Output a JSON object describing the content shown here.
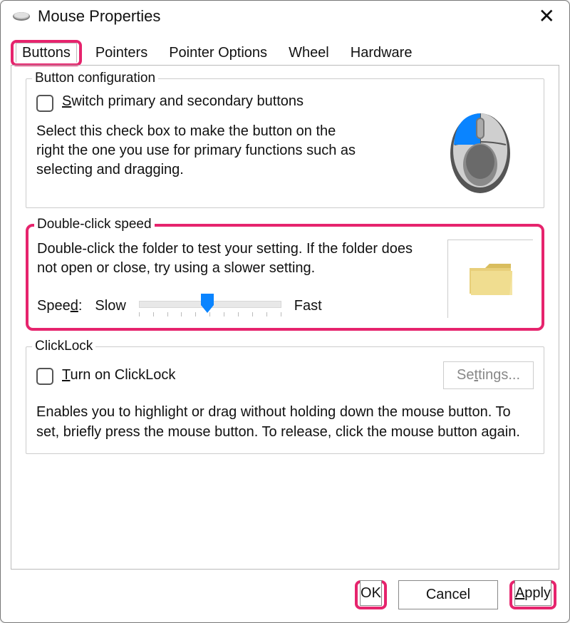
{
  "window": {
    "title": "Mouse Properties"
  },
  "tabs": [
    "Buttons",
    "Pointers",
    "Pointer Options",
    "Wheel",
    "Hardware"
  ],
  "active_tab_index": 0,
  "button_config": {
    "legend": "Button configuration",
    "checkbox_prefix": "S",
    "checkbox_rest": "witch primary and secondary buttons",
    "description": "Select this check box to make the button on the right the one you use for primary functions such as selecting and dragging."
  },
  "double_click": {
    "legend": "Double-click speed",
    "description": "Double-click the folder to test your setting. If the folder does not open or close, try using a slower setting.",
    "speed_label_pre": "Spee",
    "speed_label_u": "d",
    "speed_label_post": ":",
    "slow": "Slow",
    "fast": "Fast",
    "slider_value_percent": 48
  },
  "clicklock": {
    "legend": "ClickLock",
    "checkbox_u": "T",
    "checkbox_rest": "urn on ClickLock",
    "settings_pre": "Se",
    "settings_u": "t",
    "settings_post": "tings...",
    "description": "Enables you to highlight or drag without holding down the mouse button. To set, briefly press the mouse button. To release, click the mouse button again."
  },
  "buttons": {
    "ok": "OK",
    "cancel": "Cancel",
    "apply_u": "A",
    "apply_rest": "pply"
  },
  "highlights": {
    "color": "#e6246d",
    "tab_buttons": true,
    "double_click_group": true,
    "ok_button": true,
    "apply_button": true
  }
}
